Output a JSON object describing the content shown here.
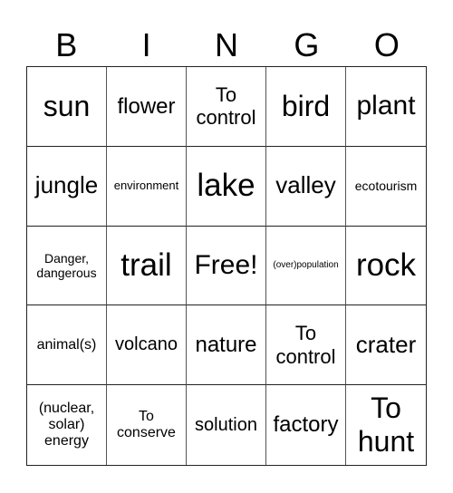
{
  "header": [
    "B",
    "I",
    "N",
    "G",
    "O"
  ],
  "cells": [
    "sun",
    "flower",
    "To\ncontrol",
    "bird",
    "plant",
    "jungle",
    "environment",
    "lake",
    "valley",
    "ecotourism",
    "Danger,\ndangerous",
    "trail",
    "Free!",
    "(over)population",
    "rock",
    "animal(s)",
    "volcano",
    "nature",
    "To\ncontrol",
    "crater",
    "(nuclear,\nsolar)\nenergy",
    "To\nconserve",
    "solution",
    "factory",
    "To\nhunt"
  ]
}
